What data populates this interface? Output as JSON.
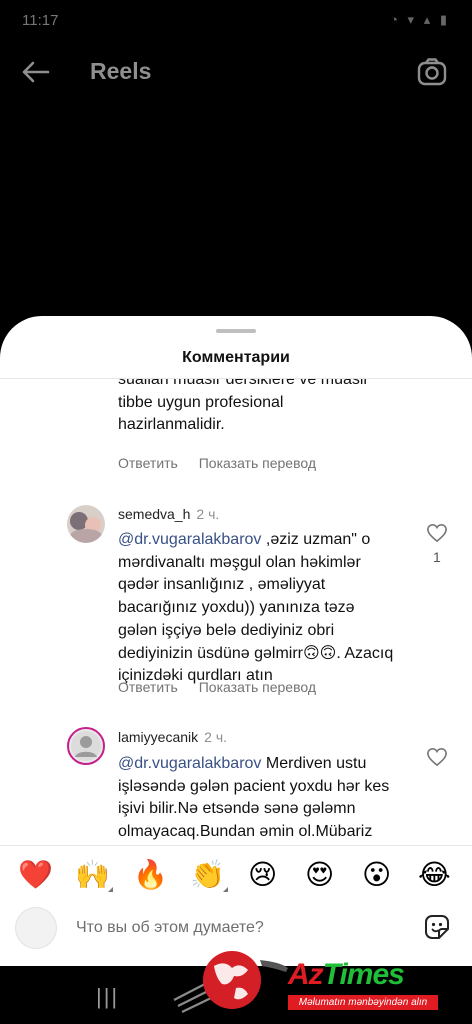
{
  "status": {
    "time": "11:17",
    "icons": "◔ ▾ ▴ ▮"
  },
  "header": {
    "title": "Reels",
    "icons": {
      "back": "back-arrow-icon",
      "camera": "camera-icon"
    }
  },
  "sheet": {
    "title": "Комментарии"
  },
  "comments": [
    {
      "text_lines": [
        "suallari muasir dersiklere ve muasir",
        "tibbe uygun profesional",
        "hazirlanmalidir."
      ],
      "actions": {
        "reply": "Ответить",
        "translate": "Показать перевод"
      }
    },
    {
      "username": "semedva_h",
      "time": "2 ч.",
      "mention": "@dr.vugaralakbarov",
      "text": " ,əziz uzman\" o mərdivanaltı məşgul olan həkimlər qədər insanlığınız , əməliyyat bacarığınız yoxdu)) yanınıza təzə gələn işçiyə belə dediyiniz obri dediyinizin üsdünə gəlmirr🙃🙃. Azacıq içinizdəki qurdları atın",
      "likes": "1",
      "actions": {
        "reply": "Ответить",
        "translate": "Показать перевод"
      }
    },
    {
      "username": "lamiyyecanik",
      "time": "2 ч.",
      "mention": "@dr.vugaralakbarov",
      "text": " Merdiven ustu işləsəndə gələn pacient yoxdu hər kes işivi bilir.Nə etsəndə sənə gələmn olmayacaq.Bundan əmin ol.Mübariz sənin fikrincə mərdivan altıdı?Video"
    }
  ],
  "emoji_bar": [
    "❤️",
    "🙌",
    "🔥",
    "👏",
    "😢",
    "😍",
    "😮",
    "😂"
  ],
  "compose": {
    "placeholder": "Что вы об этом думаете?"
  },
  "navbar": {
    "recent": "|||"
  },
  "watermark": {
    "brand_a": "Az",
    "brand_b": "Times",
    "slogan": "Məlumatın mənbəyindən alın"
  },
  "colors": {
    "mention": "#385185",
    "brand_green": "#1fbf3a",
    "brand_red": "#e11b22"
  }
}
